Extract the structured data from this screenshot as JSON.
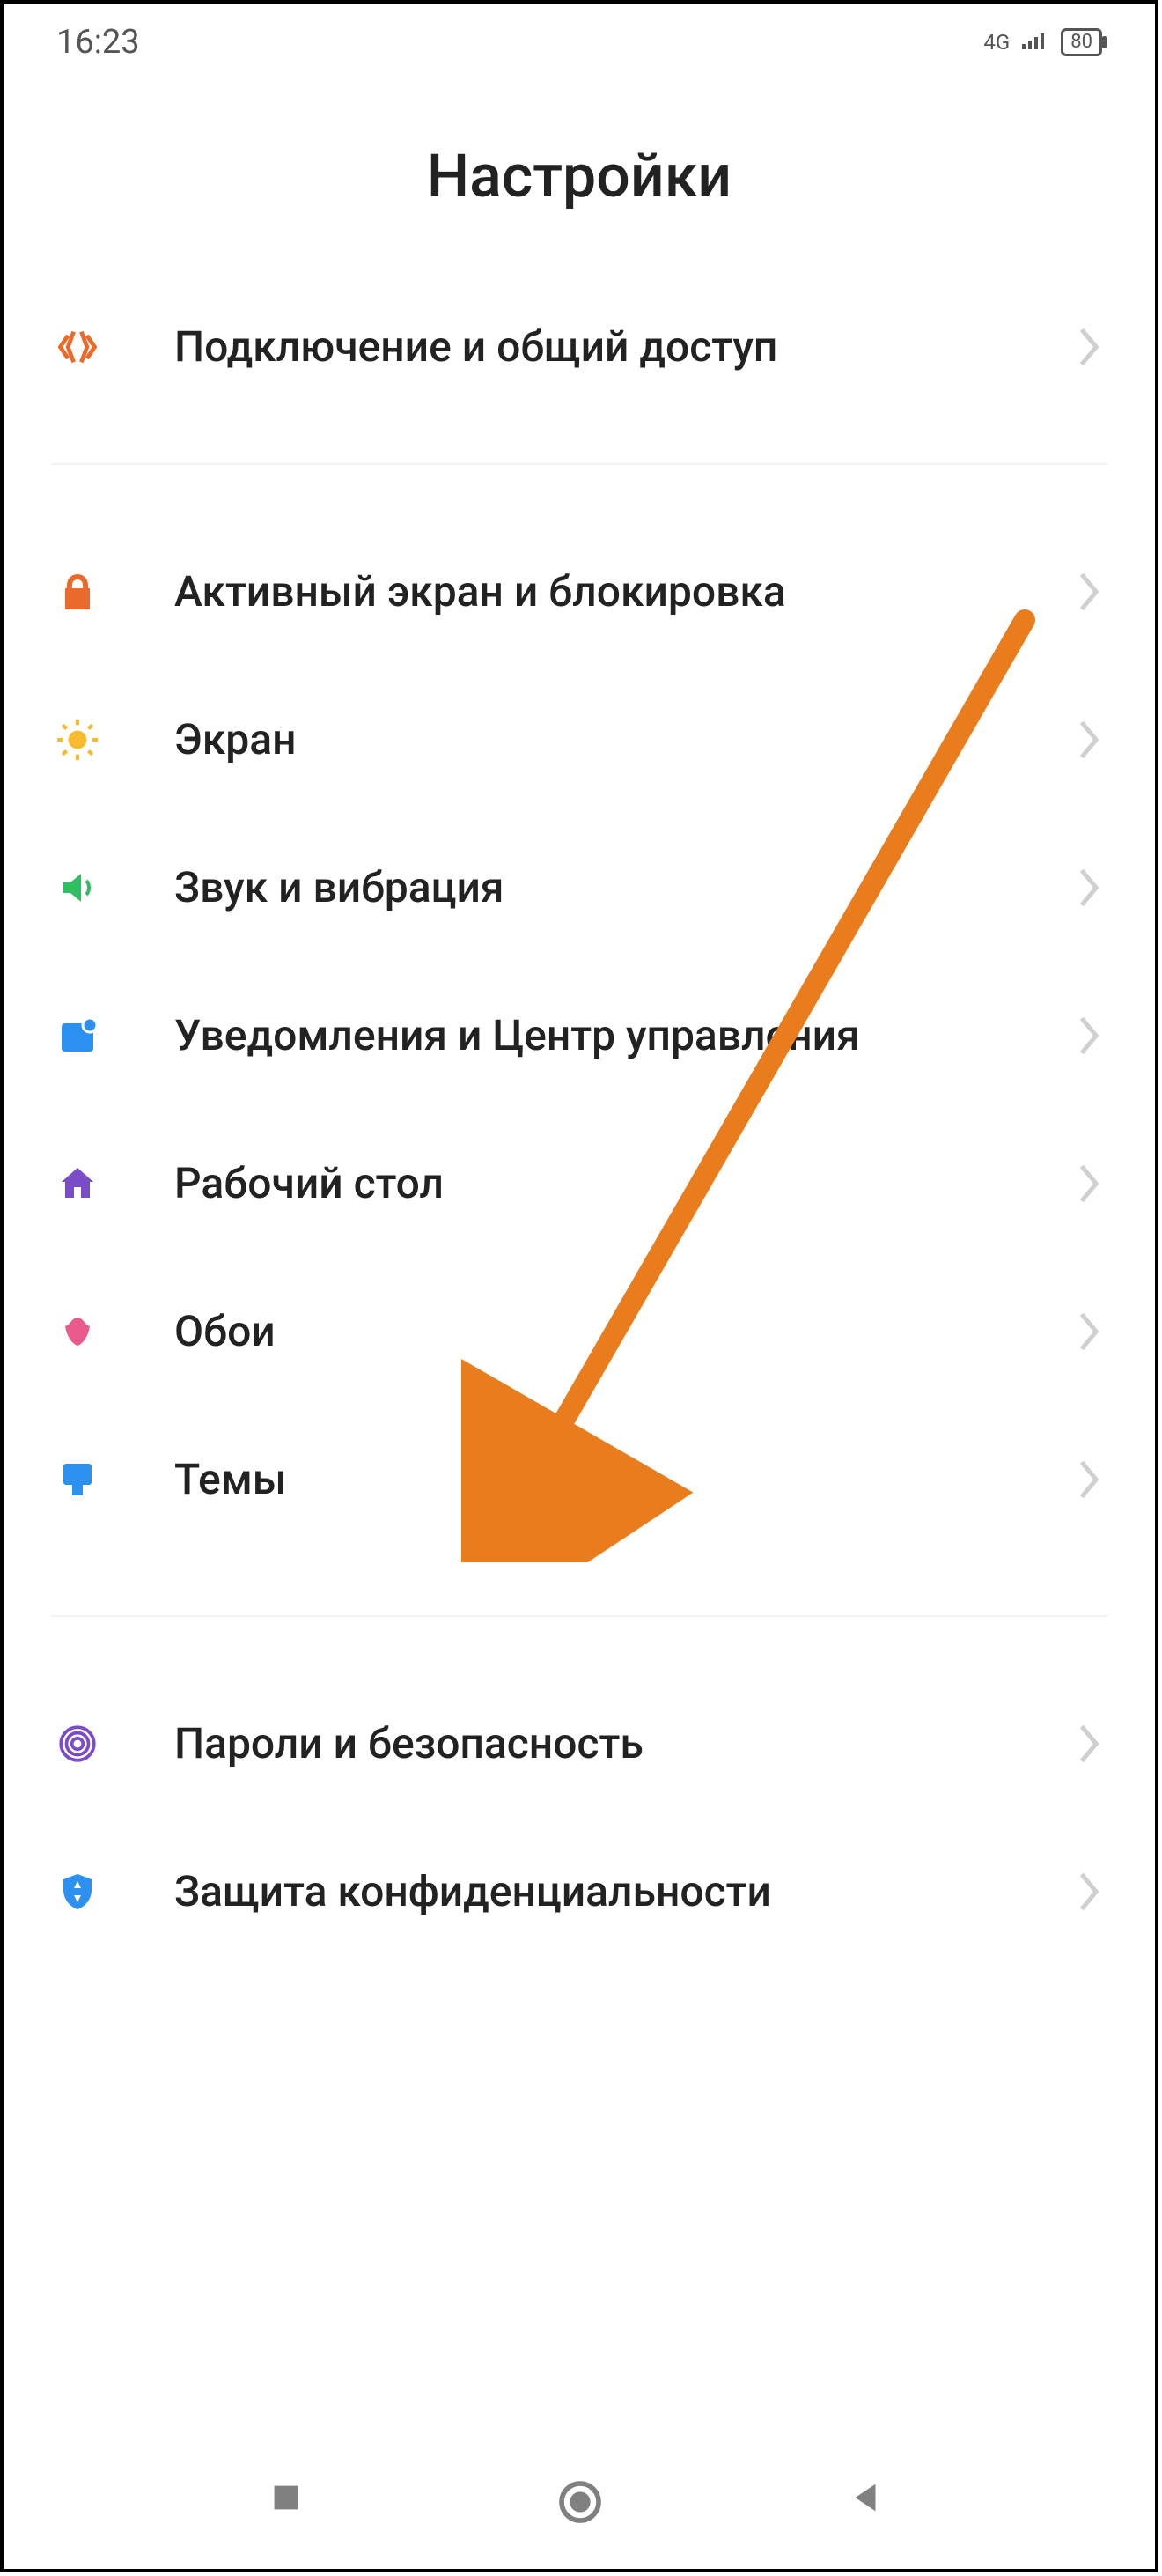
{
  "status": {
    "time": "16:23",
    "net": "4G",
    "battery": "80"
  },
  "title": "Настройки",
  "groups": [
    [
      {
        "icon": "share-icon",
        "color": "#e96a2a",
        "label": "Подключение и общий доступ"
      }
    ],
    [
      {
        "icon": "lock-icon",
        "color": "#e96a2a",
        "label": "Активный экран и блокировка"
      },
      {
        "icon": "brightness-icon",
        "color": "#f7b92d",
        "label": "Экран"
      },
      {
        "icon": "sound-icon",
        "color": "#2fbf63",
        "label": "Звук и вибрация"
      },
      {
        "icon": "notification-icon",
        "color": "#2b90ef",
        "label": "Уведомления и Центр управления"
      },
      {
        "icon": "home-icon",
        "color": "#7a4cc8",
        "label": "Рабочий стол"
      },
      {
        "icon": "wallpaper-icon",
        "color": "#e85b8b",
        "label": "Обои"
      },
      {
        "icon": "theme-icon",
        "color": "#2b90ef",
        "label": "Темы"
      }
    ],
    [
      {
        "icon": "fingerprint-icon",
        "color": "#7a4cc8",
        "label": "Пароли и безопасность"
      },
      {
        "icon": "shield-icon",
        "color": "#2b90ef",
        "label": "Защита конфиденциальности"
      }
    ]
  ],
  "annotation_arrow": {
    "color": "#e97d1d"
  }
}
